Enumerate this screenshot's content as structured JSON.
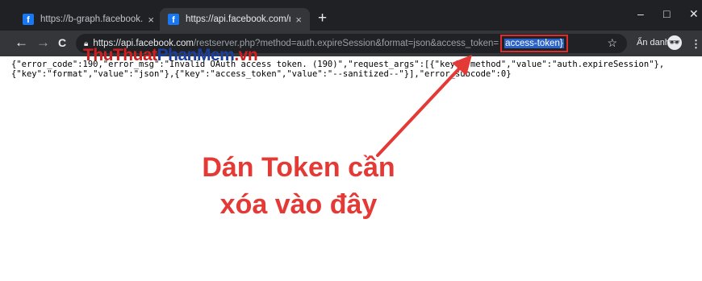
{
  "browser": {
    "tabs": [
      {
        "title": "https://b-graph.facebook.com/a",
        "favicon": "facebook-icon",
        "close": "×"
      },
      {
        "title": "https://api.facebook.com/restser",
        "favicon": "facebook-icon",
        "close": "×"
      }
    ],
    "new_tab": "+",
    "window_controls": {
      "minimize": "–",
      "maximize": "□",
      "close": "✕"
    },
    "nav": {
      "back": "←",
      "forward": "→",
      "reload": "C"
    },
    "address": {
      "host": "https://api.facebook.com",
      "path": "/restserver.php?method=auth.expireSession&format=json&access_token=",
      "token": "access-token}"
    },
    "bookmark_star": "☆",
    "profile_label": "Ẩn danh",
    "menu": "⋮"
  },
  "watermark": {
    "part1": "ThuThuat",
    "part2": "PhanMem",
    "part3": ".vn"
  },
  "page": {
    "json_line1": "{\"error_code\":190,\"error_msg\":\"Invalid OAuth access token. (190)\",\"request_args\":[{\"key\":\"method\",\"value\":\"auth.expireSession\"},",
    "json_line2": "{\"key\":\"format\",\"value\":\"json\"},{\"key\":\"access_token\",\"value\":\"--sanitized--\"}],\"error_subcode\":0}"
  },
  "annotation": {
    "line1": "Dán Token cần",
    "line2": "xóa vào đây",
    "color": "#e53935"
  }
}
